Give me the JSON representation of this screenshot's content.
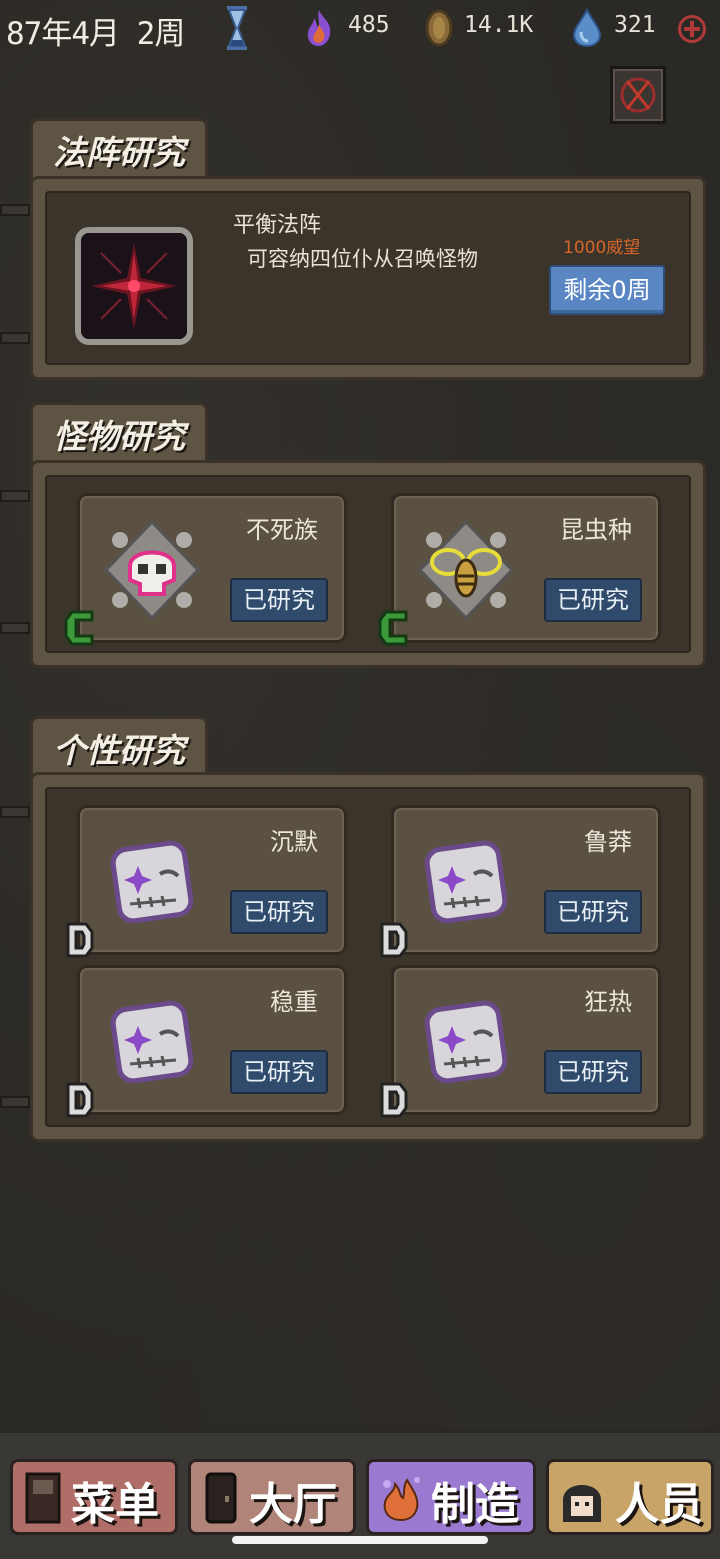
{
  "status": {
    "date": "87年4月 2周",
    "resources": [
      {
        "icon": "flame-icon",
        "value": "485"
      },
      {
        "icon": "coin-icon",
        "value": "14.1K"
      },
      {
        "icon": "water-drop-icon",
        "value": "321"
      }
    ]
  },
  "formation_section": {
    "tab_label": "法阵研究",
    "title": "平衡法阵",
    "description": "可容纳四位仆从召唤怪物",
    "cost": "1000威望",
    "remaining_label": "剩余0周"
  },
  "monster_section": {
    "tab_label": "怪物研究",
    "cards": [
      {
        "title": "不死族",
        "status": "已研究",
        "grade": "C"
      },
      {
        "title": "昆虫种",
        "status": "已研究",
        "grade": "C"
      }
    ]
  },
  "trait_section": {
    "tab_label": "个性研究",
    "cards": [
      {
        "title": "沉默",
        "status": "已研究",
        "grade": "D"
      },
      {
        "title": "鲁莽",
        "status": "已研究",
        "grade": "D"
      },
      {
        "title": "稳重",
        "status": "已研究",
        "grade": "D"
      },
      {
        "title": "狂热",
        "status": "已研究",
        "grade": "D"
      }
    ]
  },
  "bottom_nav": {
    "menu": "菜单",
    "hall": "大厅",
    "craft": "制造",
    "staff": "人员"
  },
  "colors": {
    "panel": "#5e5443",
    "panel_inner": "#3a342a",
    "done_button": "#2f4a6a",
    "remaining_button": "#5a87c4",
    "cost_text": "#d8662a",
    "grade_c": "#3c9a3a"
  }
}
